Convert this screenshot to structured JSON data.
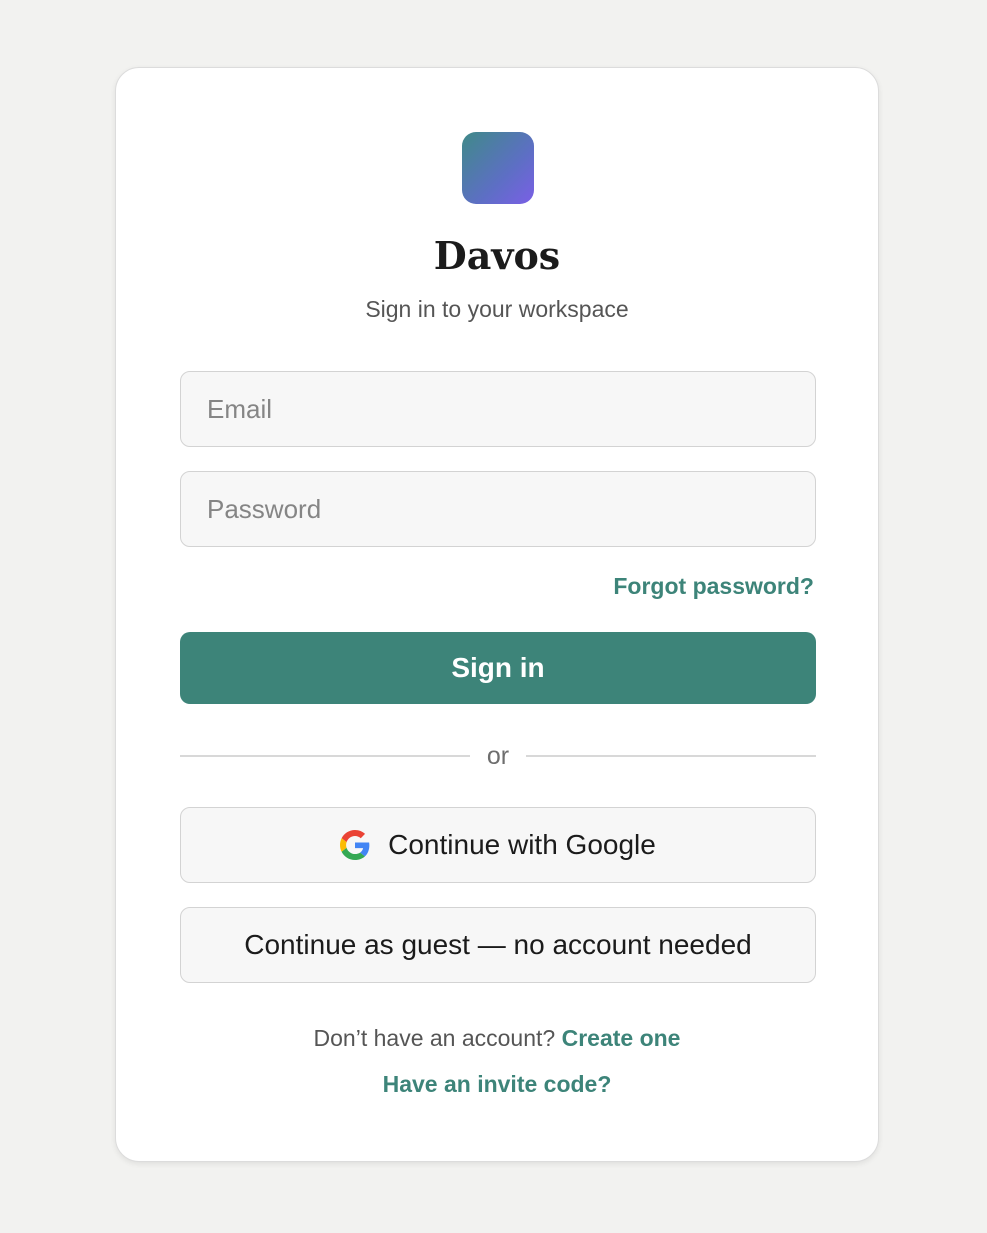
{
  "app": {
    "title": "Davos",
    "subtitle": "Sign in to your workspace"
  },
  "form": {
    "email": {
      "placeholder": "Email",
      "value": ""
    },
    "password": {
      "placeholder": "Password",
      "value": ""
    },
    "forgot_label": "Forgot password?",
    "submit_label": "Sign in"
  },
  "divider": {
    "label": "or"
  },
  "alt_auth": {
    "google_label": "Continue with Google",
    "guest_label": "Continue as guest — no account needed"
  },
  "footer": {
    "no_account_text": "Don’t have an account?",
    "create_label": "Create one",
    "invite_label": "Have an invite code?"
  },
  "icons": {
    "logo": "app-logo",
    "google": "google-g-icon"
  },
  "colors": {
    "accent": "#3d8479",
    "background": "#f2f2f0",
    "card": "#ffffff",
    "logo_gradient_start": "#3f8a88",
    "logo_gradient_end": "#7a5fe6"
  }
}
